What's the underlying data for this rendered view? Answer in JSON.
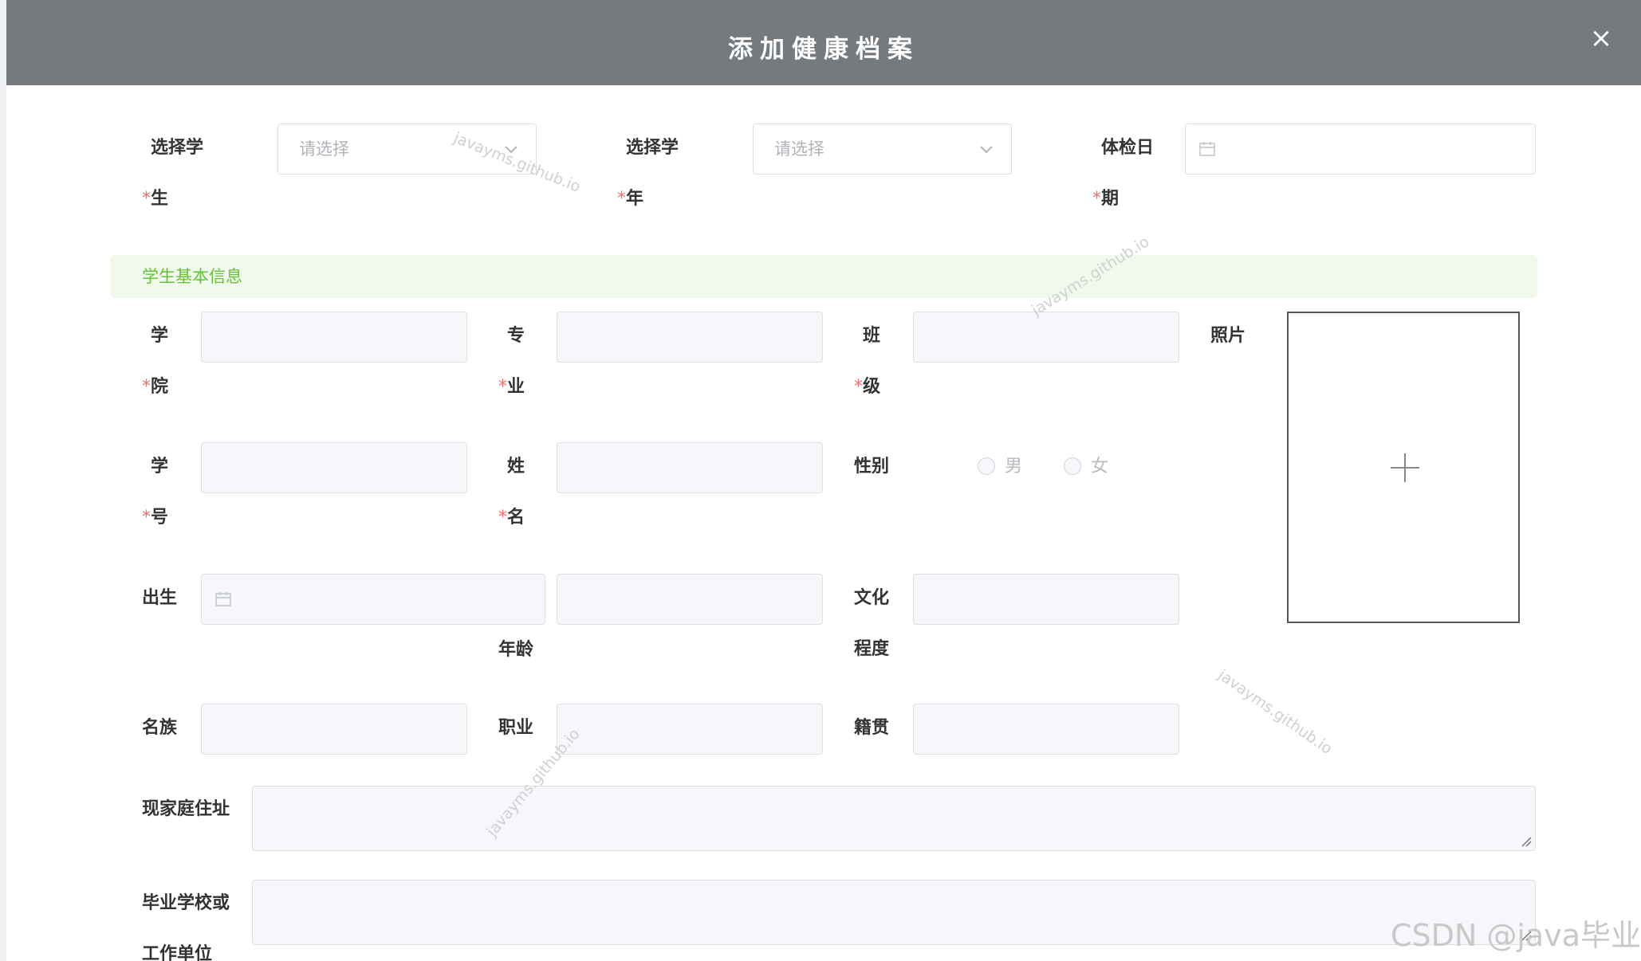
{
  "dialog": {
    "title": "添加健康档案",
    "close_glyph": "×"
  },
  "top_row": {
    "student": {
      "label": "选择学生",
      "placeholder": "请选择"
    },
    "year": {
      "label": "选择学年",
      "placeholder": "请选择"
    },
    "exam_date": {
      "label": "体检日期"
    }
  },
  "section": {
    "title": "学生基本信息"
  },
  "fields": {
    "college": "学院",
    "major": "专业",
    "class": "班级",
    "photo": "照片",
    "student_no": "学号",
    "name": "姓名",
    "gender": "性别",
    "gender_male": "男",
    "gender_female": "女",
    "birth": "出生",
    "age": "年龄",
    "education": "文化程度",
    "ethnicity": "名族",
    "occupation": "职业",
    "native_place": "籍贯",
    "address": "现家庭住址",
    "school_or_employer": "毕业学校或工作单位"
  },
  "required_mark": "*",
  "watermark": {
    "text": "javayms.github.io",
    "csdn": "CSDN @java毕业"
  },
  "icons": [
    "close-icon",
    "chevron-down-icon",
    "calendar-icon",
    "plus-icon",
    "resize-grip-icon"
  ]
}
